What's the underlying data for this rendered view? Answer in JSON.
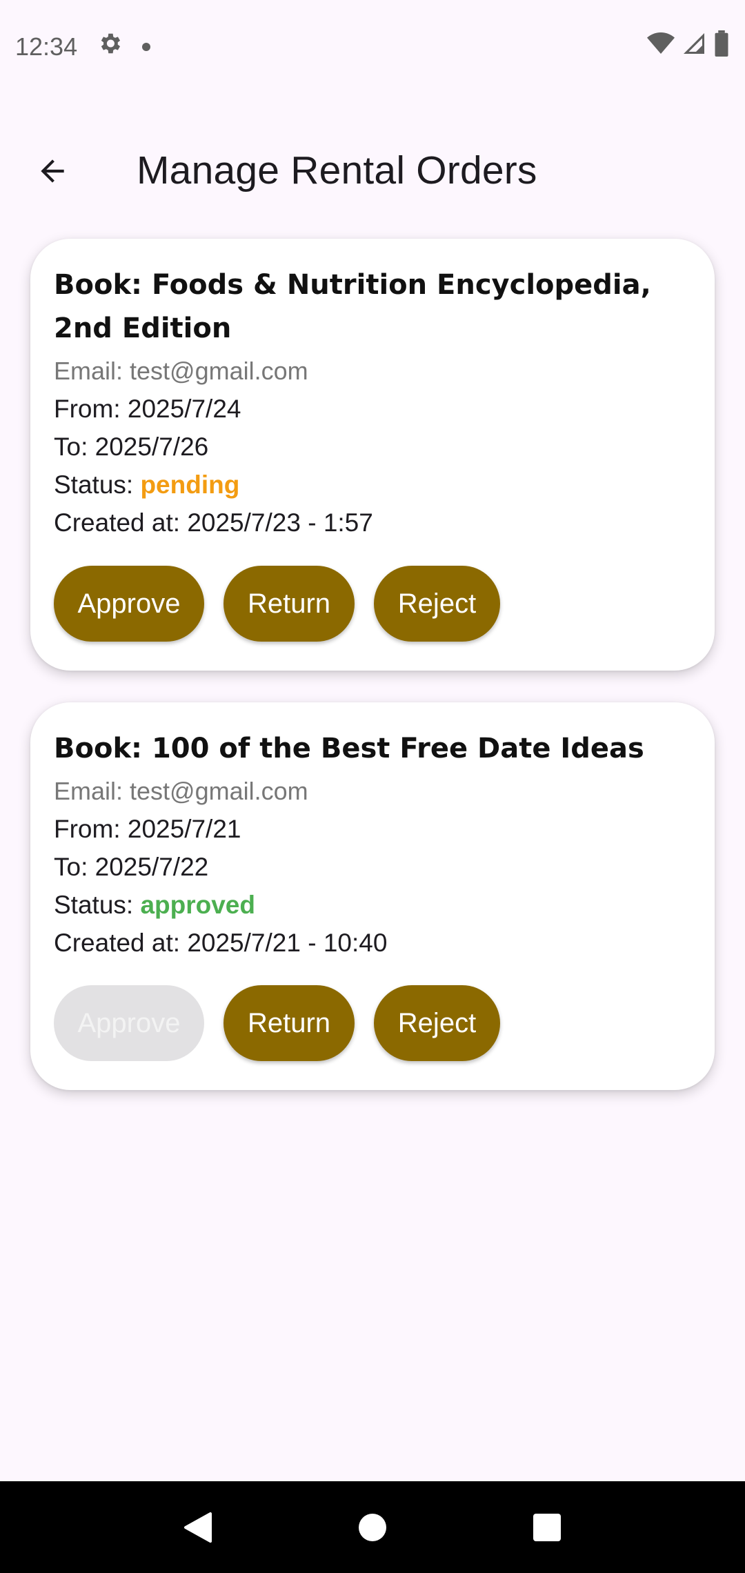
{
  "status_bar": {
    "time": "12:34"
  },
  "app_bar": {
    "title": "Manage Rental Orders"
  },
  "colors": {
    "primary": "#8b6900",
    "pending": "#f39c12",
    "approved": "#4caf50",
    "background": "#fdf7fe"
  },
  "orders": [
    {
      "title": "Book: Foods & Nutrition Encyclopedia, 2nd Edition",
      "email": "Email: test@gmail.com",
      "from": "From: 2025/7/24",
      "to": "To: 2025/7/26",
      "status_label": "Status: ",
      "status_value": "pending",
      "created": "Created at: 2025/7/23 - 1:57",
      "approve_label": "Approve",
      "return_label": "Return",
      "reject_label": "Reject",
      "approve_enabled": true
    },
    {
      "title": "Book: 100 of the Best Free Date Ideas",
      "email": "Email: test@gmail.com",
      "from": "From: 2025/7/21",
      "to": "To: 2025/7/22",
      "status_label": "Status: ",
      "status_value": "approved",
      "created": "Created at: 2025/7/21 - 10:40",
      "approve_label": "Approve",
      "return_label": "Return",
      "reject_label": "Reject",
      "approve_enabled": false
    }
  ]
}
